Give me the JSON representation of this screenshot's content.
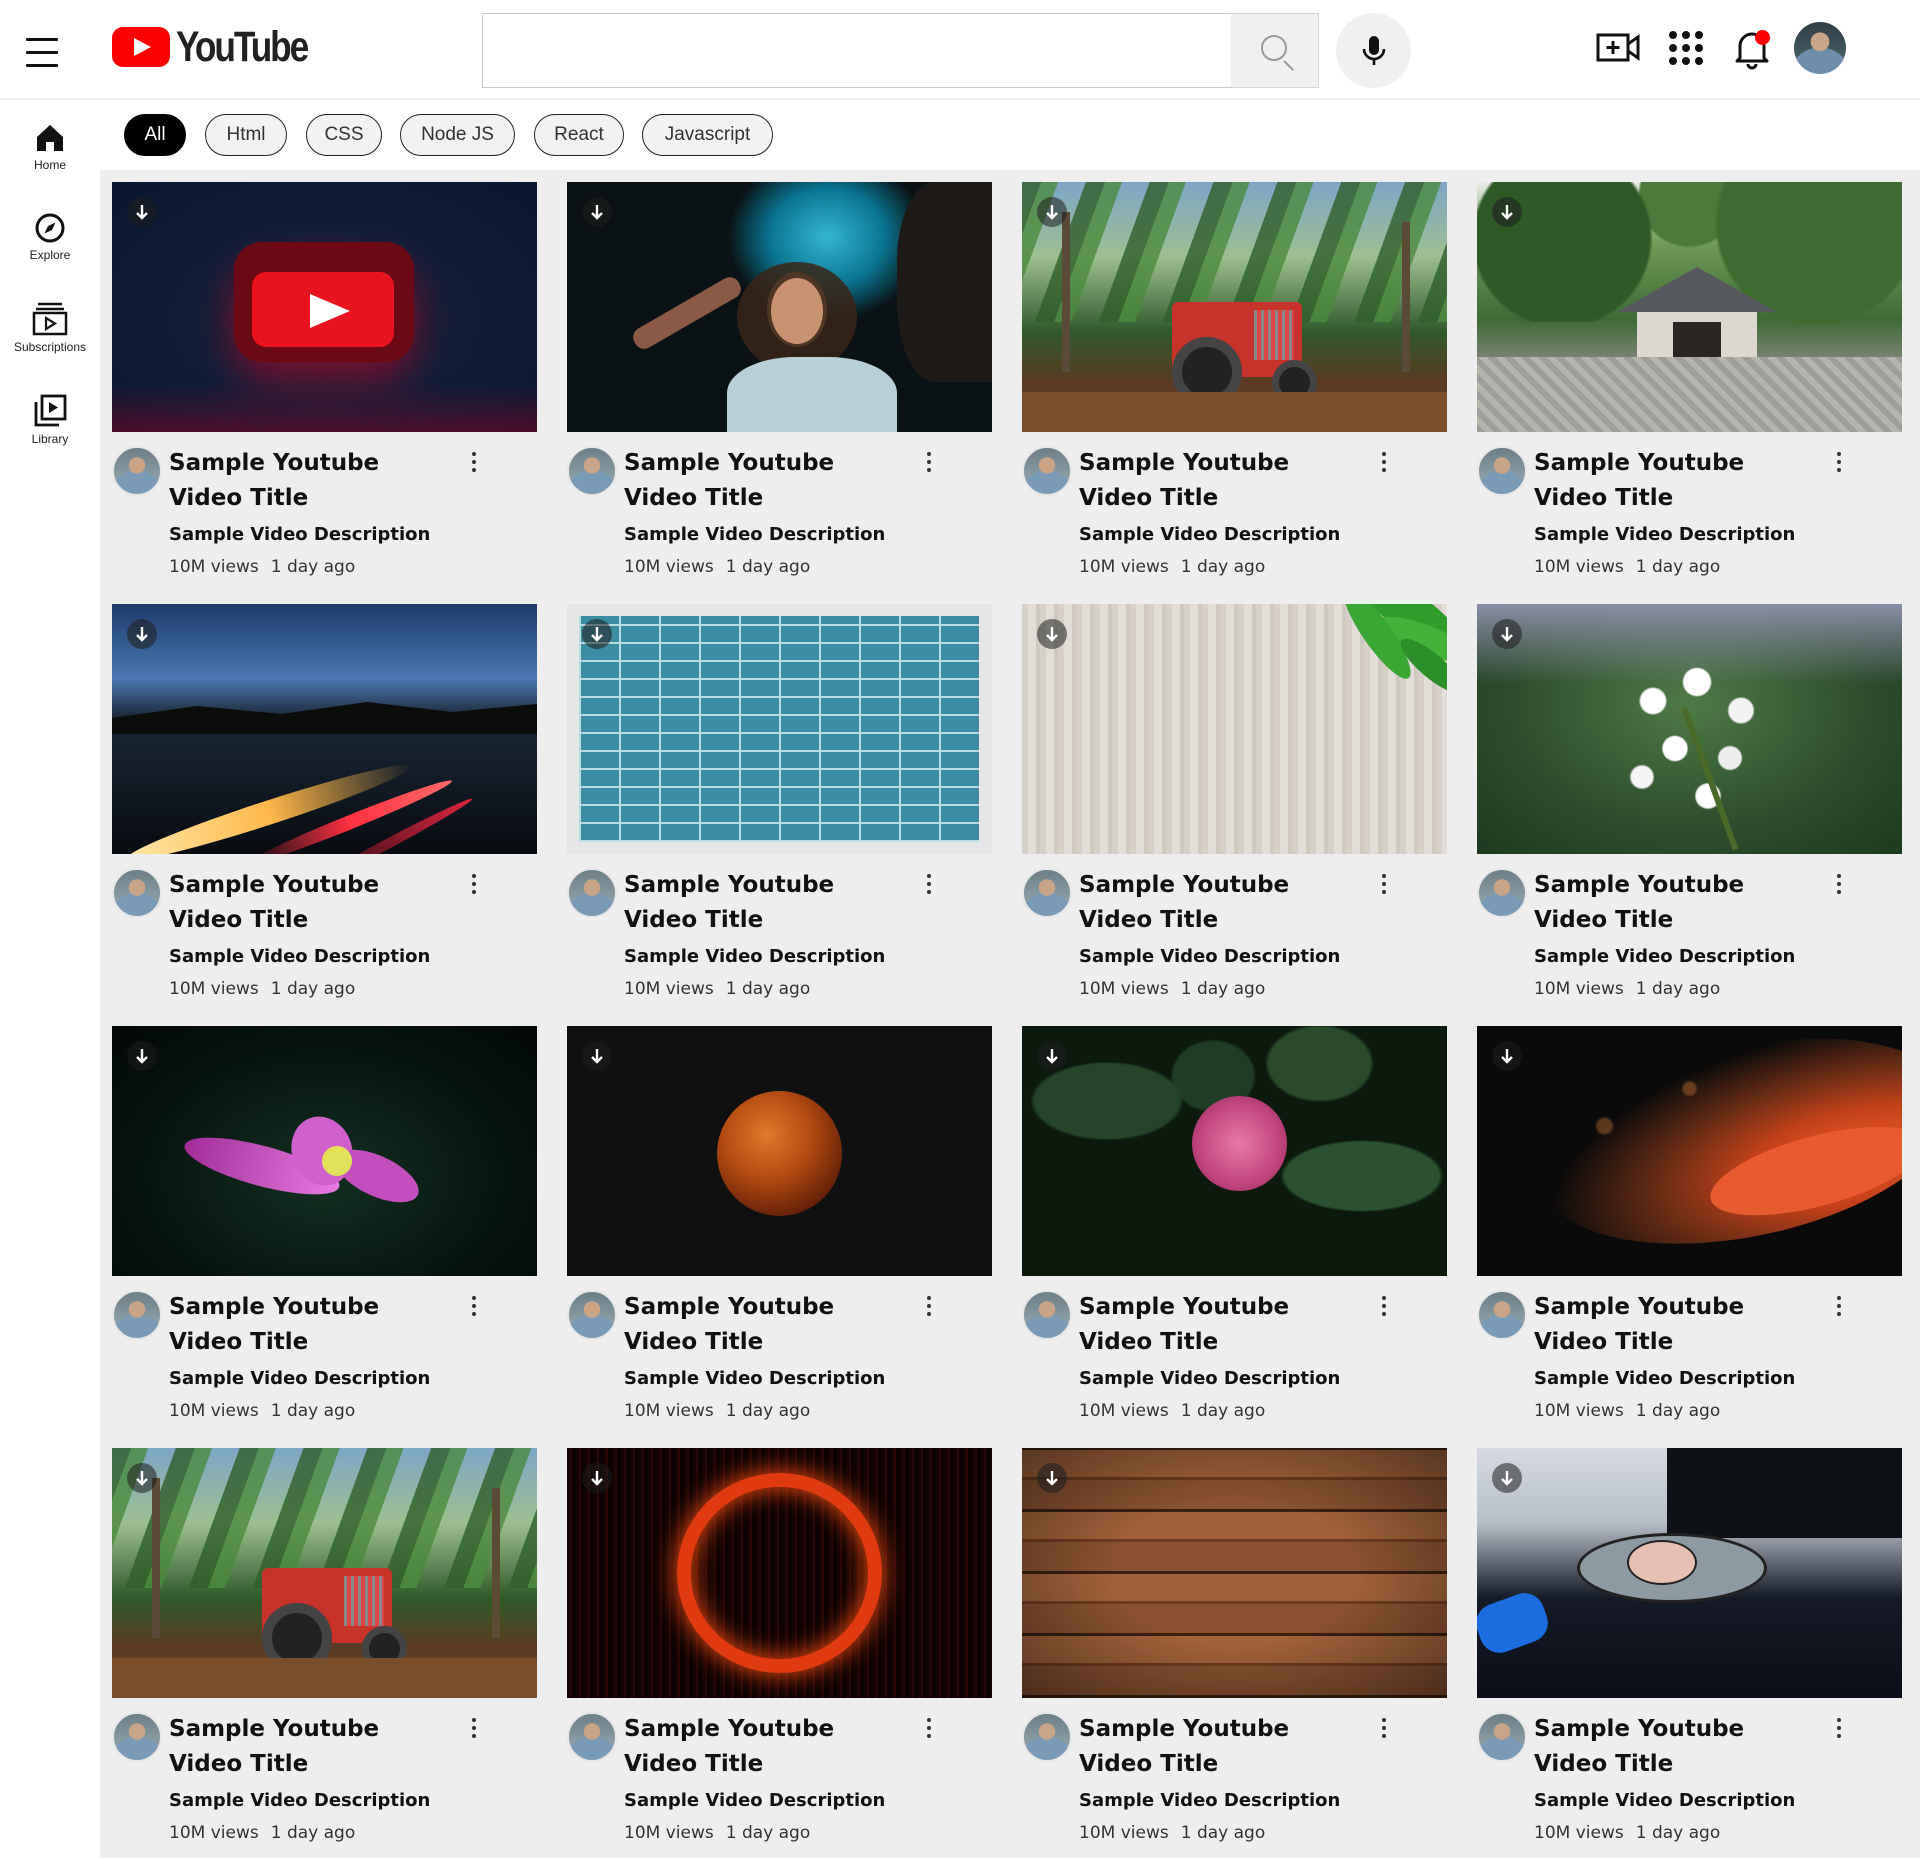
{
  "app": {
    "logo_text": "YouTube",
    "search_placeholder": "",
    "accent_color": "#ff0000"
  },
  "header_icons": [
    "create-video-icon",
    "apps-grid-icon",
    "notification-bell-icon",
    "account-avatar"
  ],
  "sidebar": {
    "items": [
      {
        "label": "Home",
        "icon": "home-icon"
      },
      {
        "label": "Explore",
        "icon": "compass-icon"
      },
      {
        "label": "Subscriptions",
        "icon": "subscriptions-icon"
      },
      {
        "label": "Library",
        "icon": "library-icon"
      }
    ]
  },
  "chips": [
    {
      "label": "All",
      "active": true
    },
    {
      "label": "Html",
      "active": false
    },
    {
      "label": "CSS",
      "active": false
    },
    {
      "label": "Node JS",
      "active": false
    },
    {
      "label": "React",
      "active": false
    },
    {
      "label": "Javascript",
      "active": false
    }
  ],
  "videos": [
    {
      "title": "Sample Youtube Video Title",
      "description": "Sample Video Description",
      "views": "10M views",
      "age": "1 day ago",
      "thumbnail": "youtube-logo-3d"
    },
    {
      "title": "Sample Youtube Video Title",
      "description": "Sample Video Description",
      "views": "10M views",
      "age": "1 day ago",
      "thumbnail": "woman-with-light-streaks"
    },
    {
      "title": "Sample Youtube Video Title",
      "description": "Sample Video Description",
      "views": "10M views",
      "age": "1 day ago",
      "thumbnail": "tractor-under-palms"
    },
    {
      "title": "Sample Youtube Video Title",
      "description": "Sample Video Description",
      "views": "10M views",
      "age": "1 day ago",
      "thumbnail": "hut-in-forest"
    },
    {
      "title": "Sample Youtube Video Title",
      "description": "Sample Video Description",
      "views": "10M views",
      "age": "1 day ago",
      "thumbnail": "highway-light-trails"
    },
    {
      "title": "Sample Youtube Video Title",
      "description": "Sample Video Description",
      "views": "10M views",
      "age": "1 day ago",
      "thumbnail": "blue-brick-wall"
    },
    {
      "title": "Sample Youtube Video Title",
      "description": "Sample Video Description",
      "views": "10M views",
      "age": "1 day ago",
      "thumbnail": "wood-with-leaves"
    },
    {
      "title": "Sample Youtube Video Title",
      "description": "Sample Video Description",
      "views": "10M views",
      "age": "1 day ago",
      "thumbnail": "white-blossoms"
    },
    {
      "title": "Sample Youtube Video Title",
      "description": "Sample Video Description",
      "views": "10M views",
      "age": "1 day ago",
      "thumbnail": "pink-flower-dark"
    },
    {
      "title": "Sample Youtube Video Title",
      "description": "Sample Video Description",
      "views": "10M views",
      "age": "1 day ago",
      "thumbnail": "planet-mars"
    },
    {
      "title": "Sample Youtube Video Title",
      "description": "Sample Video Description",
      "views": "10M views",
      "age": "1 day ago",
      "thumbnail": "pink-hydrangea"
    },
    {
      "title": "Sample Youtube Video Title",
      "description": "Sample Video Description",
      "views": "10M views",
      "age": "1 day ago",
      "thumbnail": "orange-spiral-galaxy"
    },
    {
      "title": "Sample Youtube Video Title",
      "description": "Sample Video Description",
      "views": "10M views",
      "age": "1 day ago",
      "thumbnail": "tractor-under-palms"
    },
    {
      "title": "Sample Youtube Video Title",
      "description": "Sample Video Description",
      "views": "10M views",
      "age": "1 day ago",
      "thumbnail": "red-light-ring"
    },
    {
      "title": "Sample Youtube Video Title",
      "description": "Sample Video Description",
      "views": "10M views",
      "age": "1 day ago",
      "thumbnail": "wooden-planks"
    },
    {
      "title": "Sample Youtube Video Title",
      "description": "Sample Video Description",
      "views": "10M views",
      "age": "1 day ago",
      "thumbnail": "cartoon-on-desk"
    }
  ]
}
